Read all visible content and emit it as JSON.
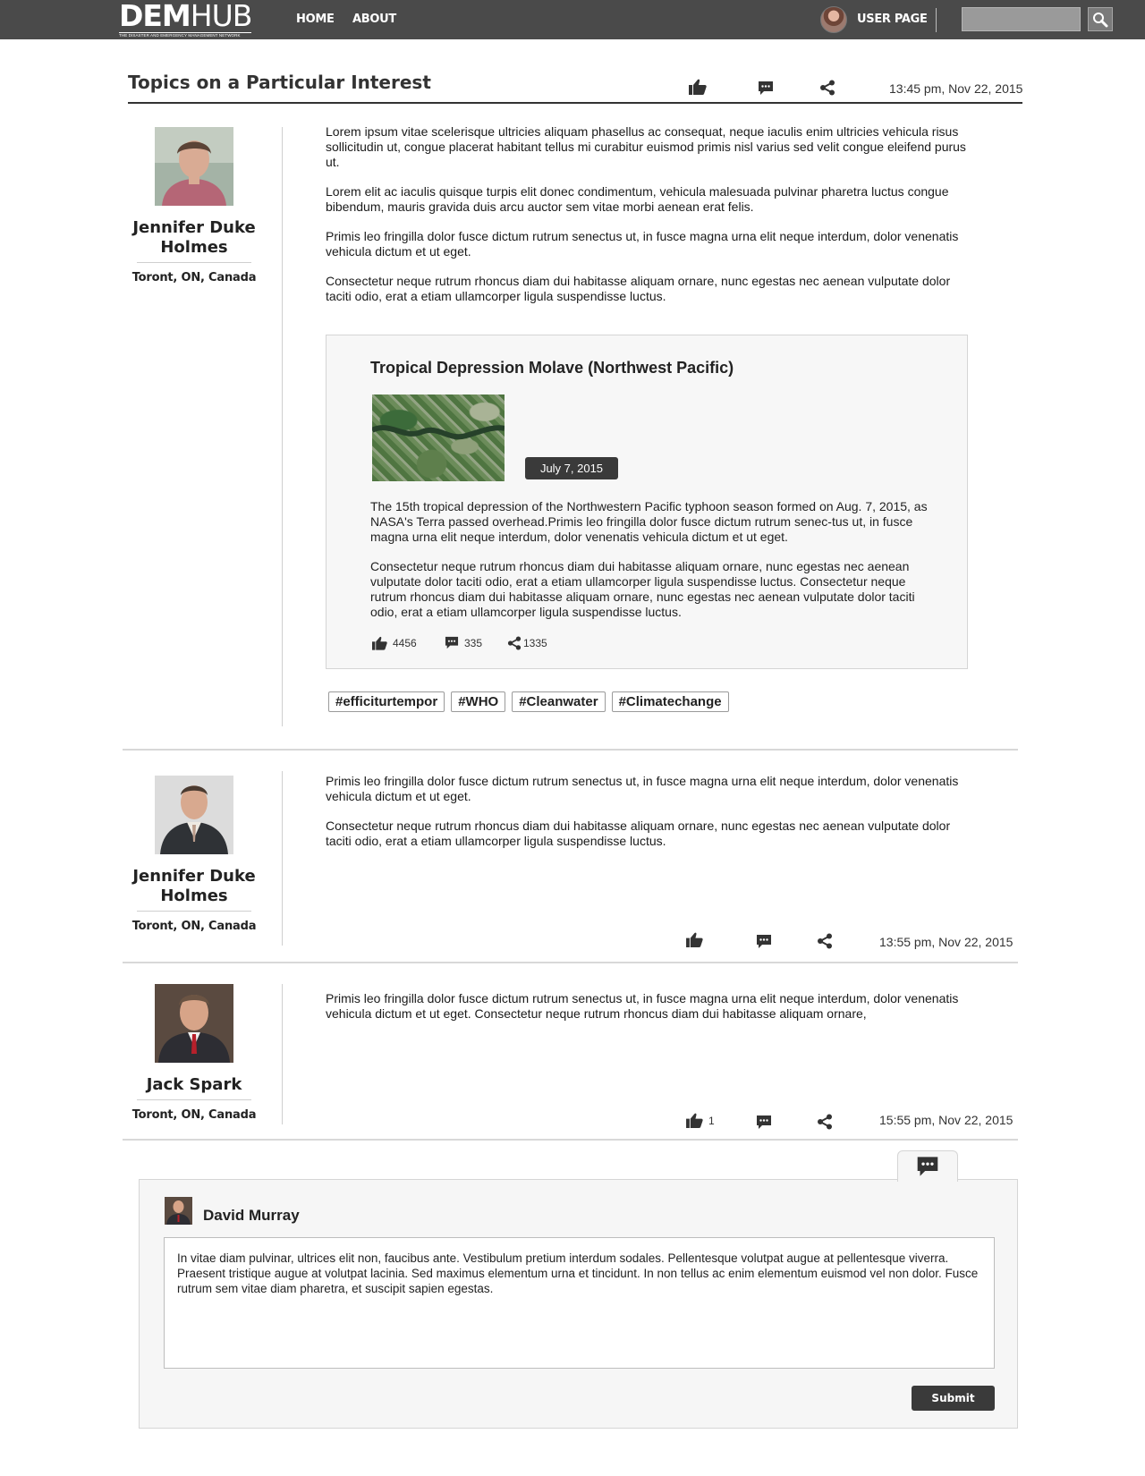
{
  "nav": {
    "logo_main_1": "DEM",
    "logo_main_2": "HUB",
    "logo_tagline": "The Disaster and Emergency Management Network",
    "home": "HOME",
    "about": "ABOUT",
    "user_page": "USER PAGE",
    "search_placeholder": ""
  },
  "page": {
    "title": "Topics on a Particular Interest",
    "timestamp": "13:45 pm, Nov 22, 2015"
  },
  "posts": [
    {
      "author": "Jennifer Duke Holmes",
      "location": "Toront, ON, Canada",
      "paragraphs": [
        "Lorem ipsum vitae scelerisque ultricies aliquam phasellus ac consequat, neque iaculis enim ultricies vehicula risus sollicitudin ut, congue placerat habitant tellus mi curabitur euismod primis nisl varius sed velit congue eleifend purus ut.",
        "Lorem elit ac iaculis quisque turpis elit donec condimentum, vehicula malesuada pulvinar pharetra luctus congue bibendum, mauris gravida duis arcu auctor sem vitae morbi aenean erat felis.",
        "Primis leo fringilla dolor fusce dictum rutrum senectus ut, in fusce magna urna elit neque interdum, dolor venenatis vehicula dictum et ut eget.",
        "Consectetur neque rutrum rhoncus diam dui habitasse aliquam ornare, nunc egestas nec aenean vulputate dolor taciti odio, erat a etiam ullamcorper ligula suspendisse luctus."
      ],
      "card": {
        "title": "Tropical Depression Molave (Northwest Pacific)",
        "date": "July 7, 2015",
        "paragraphs": [
          "The 15th tropical depression of the Northwestern Pacific typhoon season formed on Aug. 7, 2015, as NASA's Terra passed overhead.Primis leo fringilla dolor fusce dictum rutrum senec-tus ut, in fusce magna urna elit neque interdum, dolor venenatis vehicula dictum et ut eget.",
          "Consectetur neque rutrum rhoncus diam dui habitasse aliquam ornare, nunc egestas nec aenean vulputate dolor taciti odio, erat a etiam ullamcorper ligula suspendisse luctus. Consectetur neque rutrum rhoncus diam dui habitasse aliquam ornare, nunc egestas nec aenean vulputate dolor taciti odio, erat a etiam ullamcorper ligula suspendisse luctus."
        ],
        "likes": "4456",
        "comments": "335",
        "shares": "1335"
      },
      "tags": [
        "#efficiturtempor",
        "#WHO",
        "#Cleanwater",
        "#Climatechange"
      ]
    },
    {
      "author": "Jennifer Duke Holmes",
      "location": "Toront, ON, Canada",
      "paragraphs": [
        "Primis leo fringilla dolor fusce dictum rutrum senectus ut, in fusce magna urna elit neque interdum, dolor venenatis vehicula dictum et ut eget.",
        "Consectetur neque rutrum rhoncus diam dui habitasse aliquam ornare, nunc egestas nec aenean vulputate dolor taciti odio, erat a etiam ullamcorper ligula suspendisse luctus."
      ],
      "timestamp": "13:55 pm, Nov 22, 2015"
    },
    {
      "author": "Jack Spark",
      "location": "Toront, ON, Canada",
      "paragraphs": [
        "Primis leo fringilla dolor fusce dictum rutrum senectus ut, in fusce magna urna elit neque interdum, dolor venenatis vehicula dictum et ut eget.  Consectetur neque rutrum rhoncus diam dui habitasse aliquam ornare,"
      ],
      "likes": "1",
      "timestamp": "15:55 pm, Nov 22, 2015"
    }
  ],
  "comment_box": {
    "author": "David Murray",
    "text": "In vitae diam pulvinar, ultrices elit non, faucibus ante. Vestibulum pretium interdum sodales. Pellentesque volutpat augue at pellentesque viverra. Praesent tristique augue at volutpat lacinia. Sed maximus elementum urna et tincidunt. In non tellus ac enim elementum euismod vel non dolor. Fusce rutrum sem vitae diam pharetra, et suscipit sapien egestas.",
    "submit": "Submit"
  },
  "colors": {
    "nav_bg": "#4a4a4a",
    "dark_button": "#3a3a3a",
    "card_bg": "#f7f7f7"
  }
}
